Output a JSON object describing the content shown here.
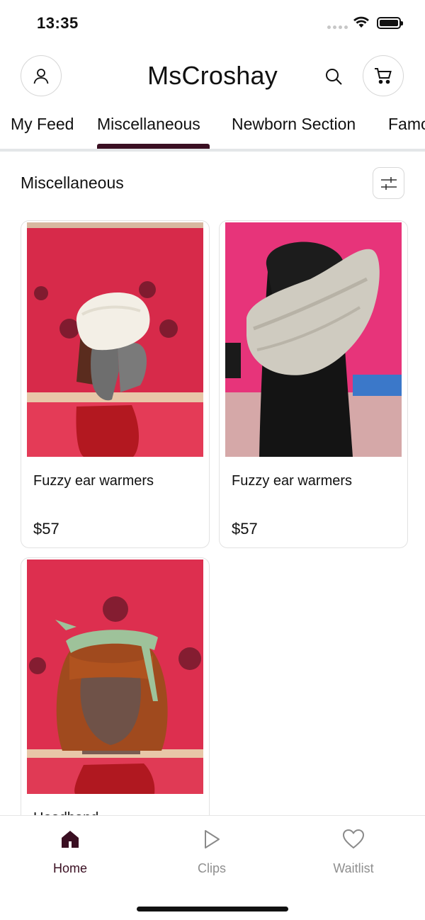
{
  "status_bar": {
    "time": "13:35"
  },
  "header": {
    "title": "MsCroshay"
  },
  "tabs": [
    {
      "label": "My Feed"
    },
    {
      "label": "Miscellaneous"
    },
    {
      "label": "Newborn Section"
    },
    {
      "label": "Famo"
    }
  ],
  "section": {
    "title": "Miscellaneous"
  },
  "products": [
    {
      "name": "Fuzzy ear warmers",
      "price": "$57"
    },
    {
      "name": "Fuzzy ear warmers",
      "price": "$57"
    },
    {
      "name": "Headband",
      "price": ""
    }
  ],
  "bottom_nav": [
    {
      "label": "Home",
      "icon": "home-icon"
    },
    {
      "label": "Clips",
      "icon": "play-icon"
    },
    {
      "label": "Waitlist",
      "icon": "heart-icon"
    }
  ],
  "colors": {
    "accent": "#3a0f22",
    "photo_background": "#d72a4a"
  }
}
